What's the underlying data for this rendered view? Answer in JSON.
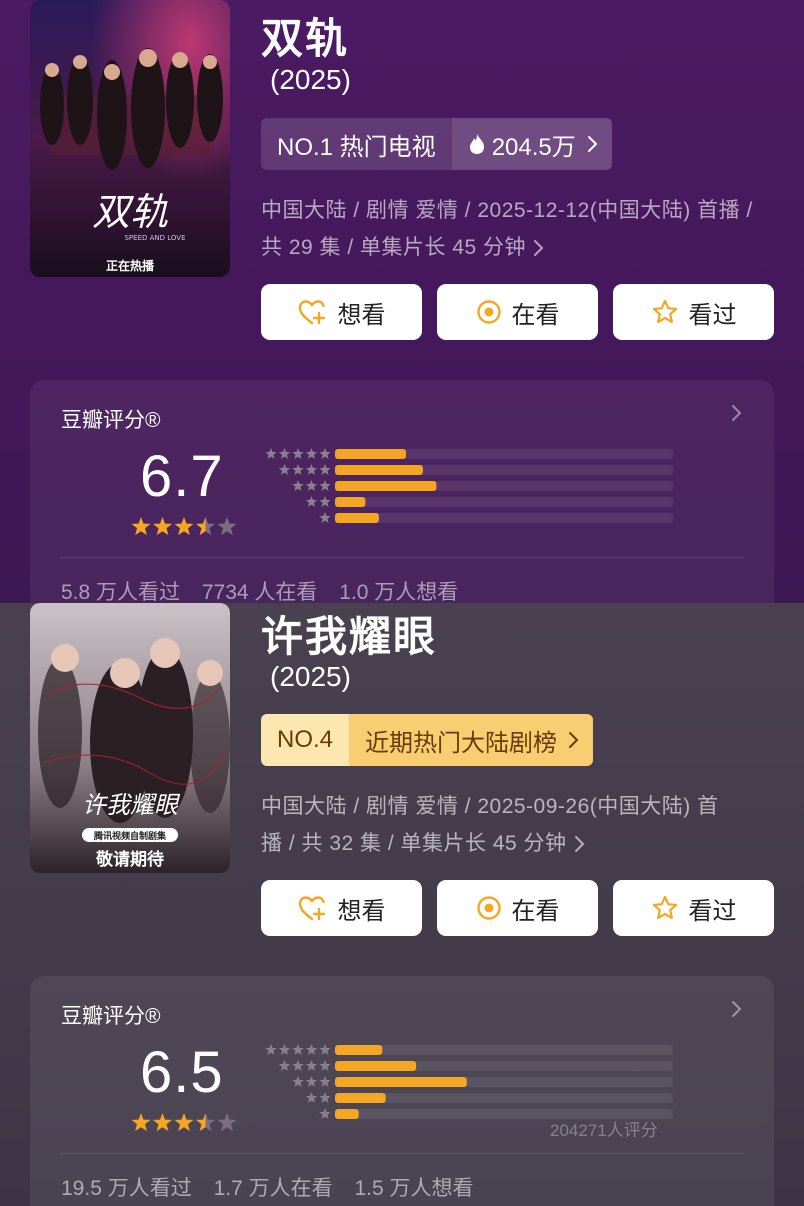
{
  "shows": [
    {
      "title": "双轨",
      "year": "(2025)",
      "rank_label": "NO.1 热门电视",
      "heat_value": "204.5万",
      "meta_line1": "中国大陆 / 剧情 爱情 / 2025-12-12(中国大陆) 首播 /",
      "meta_line2": "共 29 集 / 单集片长 45 分钟",
      "poster_title": "双轨",
      "poster_subtitle": "SPEED AND LOVE",
      "poster_status": "正在热播",
      "buttons": {
        "want": "想看",
        "watching": "在看",
        "watched": "看过"
      },
      "rating": {
        "label": "豆瓣评分®",
        "score": "6.7",
        "stars": 3.5,
        "distribution": [
          0.21,
          0.26,
          0.3,
          0.09,
          0.13
        ],
        "count_text": ""
      },
      "stats": {
        "watched": "5.8 万人看过",
        "watching": "7734 人在看",
        "want": "1.0 万人想看"
      }
    },
    {
      "title": "许我耀眼",
      "year": "(2025)",
      "rank_no": "NO.4",
      "rank_text": "近期热门大陆剧榜",
      "meta_line1": "中国大陆 / 剧情 爱情 / 2025-09-26(中国大陆) 首",
      "meta_line2": "播 / 共 32 集 / 单集片长 45 分钟",
      "poster_title": "许我耀眼",
      "poster_badge": "腾讯视频自制剧集",
      "poster_status": "敬请期待",
      "buttons": {
        "want": "想看",
        "watching": "在看",
        "watched": "看过"
      },
      "rating": {
        "label": "豆瓣评分®",
        "score": "6.5",
        "stars": 3.5,
        "distribution": [
          0.14,
          0.24,
          0.39,
          0.15,
          0.07
        ],
        "count_text": "204271人评分"
      },
      "stats": {
        "watched": "19.5 万人看过",
        "watching": "1.7 万人在看",
        "want": "1.5 万人想看"
      }
    }
  ],
  "colors": {
    "bar": "#f5a623",
    "bar_track": "rgba(255,255,255,0.08)",
    "star_on": "#f5a623",
    "star_off": "#7a6f80",
    "rank_gold_bg": "#fde7b0",
    "rank_gold_text": "#6b3a00"
  }
}
